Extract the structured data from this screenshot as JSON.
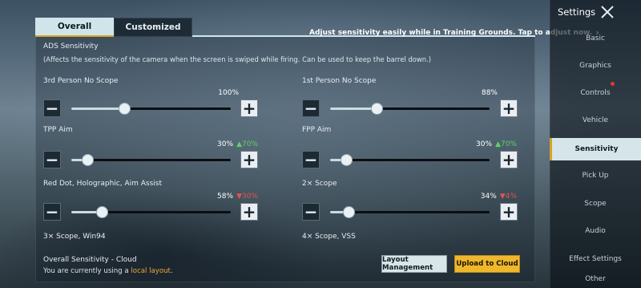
{
  "tabs": [
    {
      "label": "Overall",
      "active": true
    },
    {
      "label": "Customized",
      "active": false
    }
  ],
  "hint": {
    "text": "Adjust sensitivity easily while in Training Grounds. Tap to adjust now."
  },
  "section": {
    "title": "ADS Sensitivity",
    "description": "(Affects the sensitivity of the camera when the screen is swiped while firing. Can be used to keep the barrel down.)"
  },
  "sliders": [
    {
      "label": "3rd Person No Scope",
      "value": 100,
      "value_text": "100%",
      "delta": "",
      "delta_dir": ""
    },
    {
      "label": "1st Person No Scope",
      "value": 88,
      "value_text": "88%",
      "delta": "",
      "delta_dir": ""
    },
    {
      "label": "TPP Aim",
      "value": 30,
      "value_text": "30%",
      "delta": "70%",
      "delta_dir": "up"
    },
    {
      "label": "FPP Aim",
      "value": 30,
      "value_text": "30%",
      "delta": "70%",
      "delta_dir": "up"
    },
    {
      "label": "Red Dot, Holographic, Aim Assist",
      "value": 58,
      "value_text": "58%",
      "delta": "30%",
      "delta_dir": "down"
    },
    {
      "label": "2× Scope",
      "value": 34,
      "value_text": "34%",
      "delta": "4%",
      "delta_dir": "down"
    }
  ],
  "more_labels": [
    "3× Scope, Win94",
    "4× Scope, VSS"
  ],
  "cloud": {
    "title": "Overall Sensitivity - Cloud",
    "desc_prefix": "You are currently using a ",
    "desc_link": "local layout",
    "desc_suffix": ".",
    "layout_button": "Layout Management",
    "upload_button": "Upload to Cloud"
  },
  "sidebar": {
    "title": "Settings",
    "items": [
      {
        "label": "Basic",
        "active": false
      },
      {
        "label": "Graphics",
        "active": false
      },
      {
        "label": "Controls",
        "active": false,
        "badge": true
      },
      {
        "label": "Vehicle",
        "active": false
      },
      {
        "label": "Sensitivity",
        "active": true
      },
      {
        "label": "Pick Up",
        "active": false
      },
      {
        "label": "Scope",
        "active": false
      },
      {
        "label": "Audio",
        "active": false
      },
      {
        "label": "Effect Settings",
        "active": false
      },
      {
        "label": "Other",
        "active": false
      }
    ]
  },
  "colors": {
    "accent": "#efb72b",
    "delta_up": "#5fd06a",
    "delta_down": "#e0554d",
    "active_tab": "#cfe5ea"
  }
}
